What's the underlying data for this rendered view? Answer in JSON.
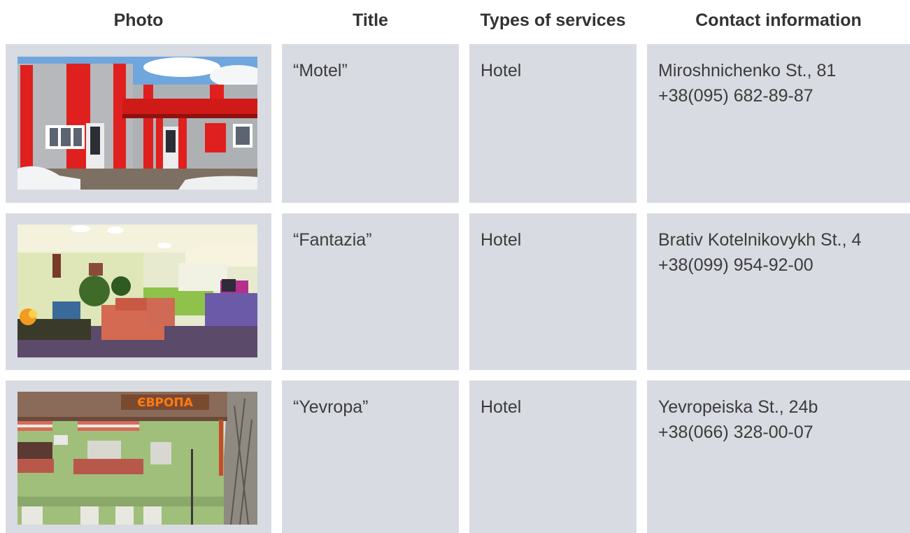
{
  "headers": {
    "photo": "Photo",
    "title": "Title",
    "services": "Types of services",
    "contact": "Contact information"
  },
  "rows": [
    {
      "photo_icon": "motel-photo",
      "title": "“Motel”",
      "service": "Hotel",
      "address": "Miroshnichenko St., 81",
      "phone": "+38(095) 682-89-87"
    },
    {
      "photo_icon": "fantazia-photo",
      "title": "“Fantazia”",
      "service": "Hotel",
      "address": "Brativ Kotelnikovykh St., 4",
      "phone": "+38(099) 954-92-00"
    },
    {
      "photo_icon": "yevropa-photo",
      "title": "“Yevropa”",
      "service": "Hotel",
      "address": "Yevropeiska St., 24b",
      "phone": "+38(066) 328-00-07",
      "sign": "ЄВРОПА"
    }
  ],
  "colors": {
    "cell_bg": "#d8dbe1",
    "motel_red": "#e0201e",
    "sky": "#6fa6dd"
  }
}
